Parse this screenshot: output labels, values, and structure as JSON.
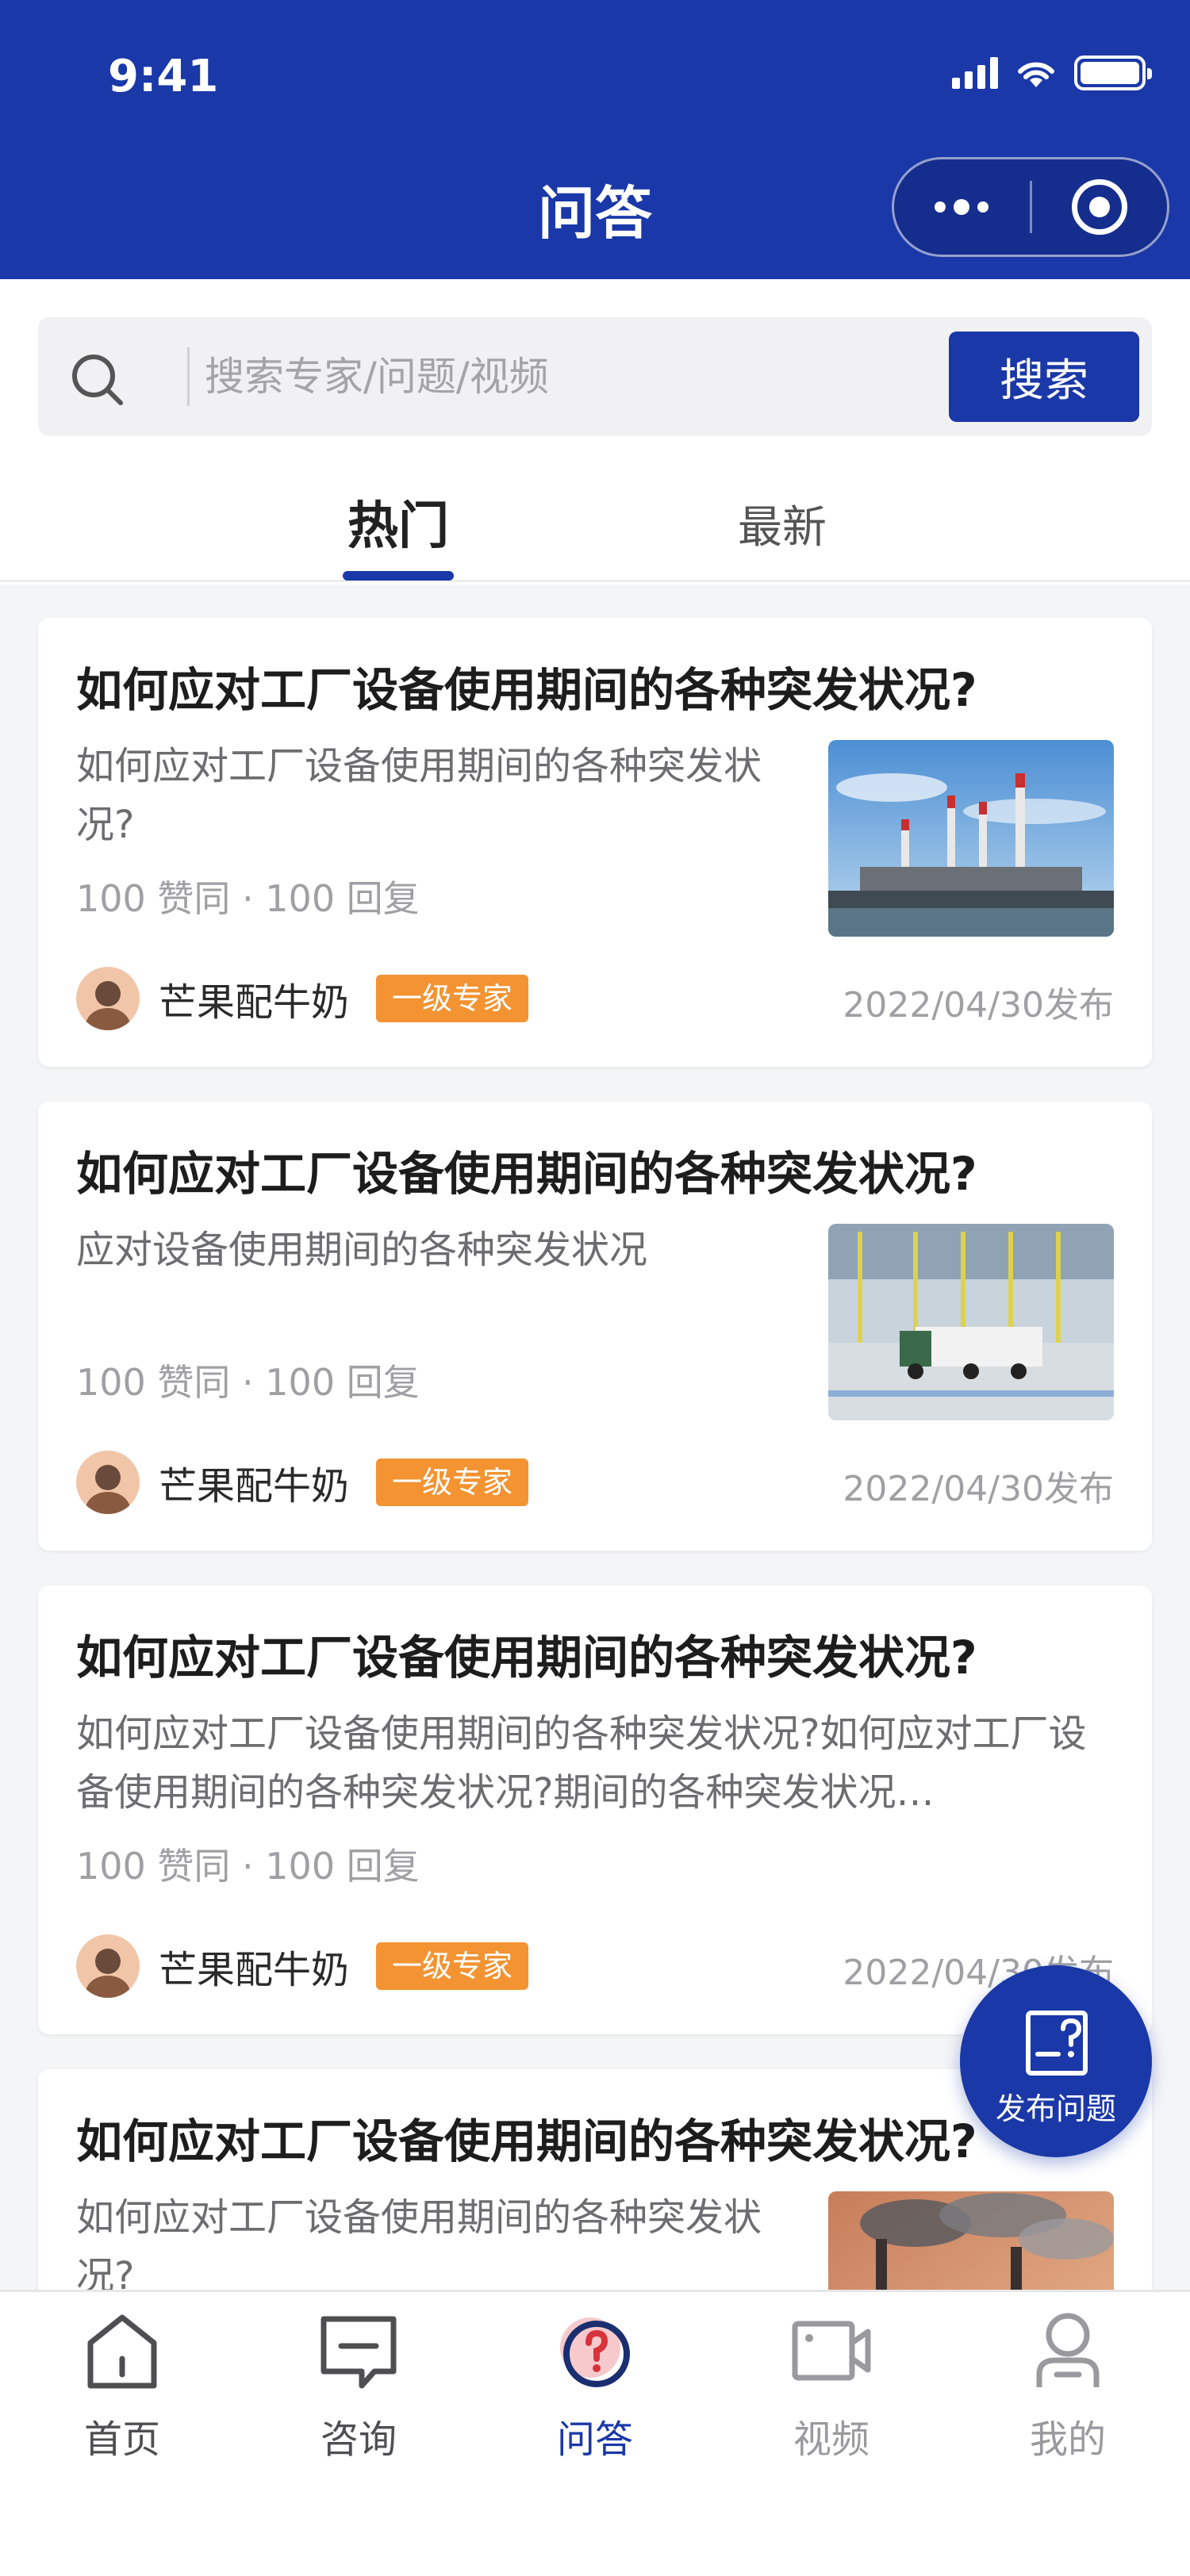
{
  "status_bar": {
    "time": "9:41"
  },
  "header": {
    "title": "问答"
  },
  "search": {
    "placeholder": "搜索专家/问题/视频",
    "button_label": "搜索"
  },
  "tabs": [
    {
      "label": "热门",
      "active": true
    },
    {
      "label": "最新",
      "active": false
    }
  ],
  "questions": [
    {
      "title": "如何应对工厂设备使用期间的各种突发状况?",
      "description": "如何应对工厂设备使用期间的各种突发状况?",
      "stats": "100 赞同 · 100 回复",
      "author": "芒果配牛奶",
      "badge": "一级专家",
      "date": "2022/04/30发布",
      "thumbnail": "factory-chimneys-image"
    },
    {
      "title": "如何应对工厂设备使用期间的各种突发状况?",
      "description": "应对设备使用期间的各种突发状况",
      "stats": "100 赞同 · 100 回复",
      "author": "芒果配牛奶",
      "badge": "一级专家",
      "date": "2022/04/30发布",
      "thumbnail": "truck-warehouse-image"
    },
    {
      "title": "如何应对工厂设备使用期间的各种突发状况?",
      "description": "如何应对工厂设备使用期间的各种突发状况?如何应对工厂设备使用期间的各种突发状况?期间的各种突发状况…",
      "stats": "100 赞同 · 100 回复",
      "author": "芒果配牛奶",
      "badge": "一级专家",
      "date": "2022/04/30发布",
      "thumbnail": null
    },
    {
      "title": "如何应对工厂设备使用期间的各种突发状况?",
      "description": "如何应对工厂设备使用期间的各种突发状况?",
      "thumbnail": "smoke-stack-image"
    }
  ],
  "fab": {
    "label": "发布问题",
    "icon": "question-doc-icon"
  },
  "bottom_nav": [
    {
      "label": "首页",
      "icon": "home-icon",
      "active": false
    },
    {
      "label": "咨询",
      "icon": "chat-icon",
      "active": false
    },
    {
      "label": "问答",
      "icon": "question-icon",
      "active": true
    },
    {
      "label": "视频",
      "icon": "video-camera-icon",
      "active": false
    },
    {
      "label": "我的",
      "icon": "user-icon",
      "active": false
    }
  ],
  "colors": {
    "primary": "#1a38a8",
    "badge": "#f39332",
    "background": "#f4f5f7"
  }
}
